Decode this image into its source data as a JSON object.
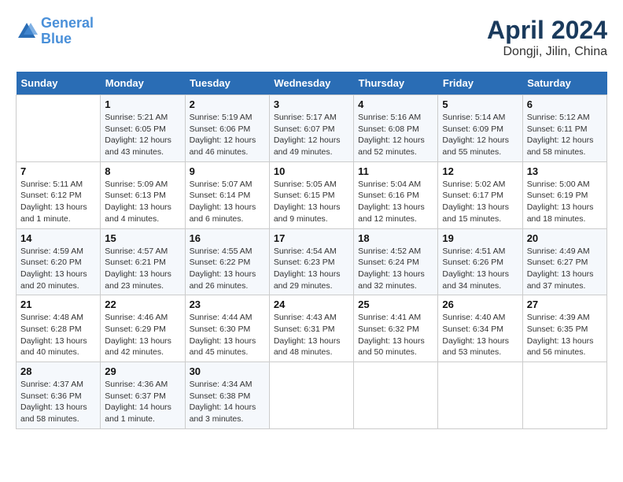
{
  "header": {
    "logo_line1": "General",
    "logo_line2": "Blue",
    "title": "April 2024",
    "subtitle": "Dongji, Jilin, China"
  },
  "columns": [
    "Sunday",
    "Monday",
    "Tuesday",
    "Wednesday",
    "Thursday",
    "Friday",
    "Saturday"
  ],
  "weeks": [
    [
      {
        "day": "",
        "info": ""
      },
      {
        "day": "1",
        "info": "Sunrise: 5:21 AM\nSunset: 6:05 PM\nDaylight: 12 hours\nand 43 minutes."
      },
      {
        "day": "2",
        "info": "Sunrise: 5:19 AM\nSunset: 6:06 PM\nDaylight: 12 hours\nand 46 minutes."
      },
      {
        "day": "3",
        "info": "Sunrise: 5:17 AM\nSunset: 6:07 PM\nDaylight: 12 hours\nand 49 minutes."
      },
      {
        "day": "4",
        "info": "Sunrise: 5:16 AM\nSunset: 6:08 PM\nDaylight: 12 hours\nand 52 minutes."
      },
      {
        "day": "5",
        "info": "Sunrise: 5:14 AM\nSunset: 6:09 PM\nDaylight: 12 hours\nand 55 minutes."
      },
      {
        "day": "6",
        "info": "Sunrise: 5:12 AM\nSunset: 6:11 PM\nDaylight: 12 hours\nand 58 minutes."
      }
    ],
    [
      {
        "day": "7",
        "info": "Sunrise: 5:11 AM\nSunset: 6:12 PM\nDaylight: 13 hours\nand 1 minute."
      },
      {
        "day": "8",
        "info": "Sunrise: 5:09 AM\nSunset: 6:13 PM\nDaylight: 13 hours\nand 4 minutes."
      },
      {
        "day": "9",
        "info": "Sunrise: 5:07 AM\nSunset: 6:14 PM\nDaylight: 13 hours\nand 6 minutes."
      },
      {
        "day": "10",
        "info": "Sunrise: 5:05 AM\nSunset: 6:15 PM\nDaylight: 13 hours\nand 9 minutes."
      },
      {
        "day": "11",
        "info": "Sunrise: 5:04 AM\nSunset: 6:16 PM\nDaylight: 13 hours\nand 12 minutes."
      },
      {
        "day": "12",
        "info": "Sunrise: 5:02 AM\nSunset: 6:17 PM\nDaylight: 13 hours\nand 15 minutes."
      },
      {
        "day": "13",
        "info": "Sunrise: 5:00 AM\nSunset: 6:19 PM\nDaylight: 13 hours\nand 18 minutes."
      }
    ],
    [
      {
        "day": "14",
        "info": "Sunrise: 4:59 AM\nSunset: 6:20 PM\nDaylight: 13 hours\nand 20 minutes."
      },
      {
        "day": "15",
        "info": "Sunrise: 4:57 AM\nSunset: 6:21 PM\nDaylight: 13 hours\nand 23 minutes."
      },
      {
        "day": "16",
        "info": "Sunrise: 4:55 AM\nSunset: 6:22 PM\nDaylight: 13 hours\nand 26 minutes."
      },
      {
        "day": "17",
        "info": "Sunrise: 4:54 AM\nSunset: 6:23 PM\nDaylight: 13 hours\nand 29 minutes."
      },
      {
        "day": "18",
        "info": "Sunrise: 4:52 AM\nSunset: 6:24 PM\nDaylight: 13 hours\nand 32 minutes."
      },
      {
        "day": "19",
        "info": "Sunrise: 4:51 AM\nSunset: 6:26 PM\nDaylight: 13 hours\nand 34 minutes."
      },
      {
        "day": "20",
        "info": "Sunrise: 4:49 AM\nSunset: 6:27 PM\nDaylight: 13 hours\nand 37 minutes."
      }
    ],
    [
      {
        "day": "21",
        "info": "Sunrise: 4:48 AM\nSunset: 6:28 PM\nDaylight: 13 hours\nand 40 minutes."
      },
      {
        "day": "22",
        "info": "Sunrise: 4:46 AM\nSunset: 6:29 PM\nDaylight: 13 hours\nand 42 minutes."
      },
      {
        "day": "23",
        "info": "Sunrise: 4:44 AM\nSunset: 6:30 PM\nDaylight: 13 hours\nand 45 minutes."
      },
      {
        "day": "24",
        "info": "Sunrise: 4:43 AM\nSunset: 6:31 PM\nDaylight: 13 hours\nand 48 minutes."
      },
      {
        "day": "25",
        "info": "Sunrise: 4:41 AM\nSunset: 6:32 PM\nDaylight: 13 hours\nand 50 minutes."
      },
      {
        "day": "26",
        "info": "Sunrise: 4:40 AM\nSunset: 6:34 PM\nDaylight: 13 hours\nand 53 minutes."
      },
      {
        "day": "27",
        "info": "Sunrise: 4:39 AM\nSunset: 6:35 PM\nDaylight: 13 hours\nand 56 minutes."
      }
    ],
    [
      {
        "day": "28",
        "info": "Sunrise: 4:37 AM\nSunset: 6:36 PM\nDaylight: 13 hours\nand 58 minutes."
      },
      {
        "day": "29",
        "info": "Sunrise: 4:36 AM\nSunset: 6:37 PM\nDaylight: 14 hours\nand 1 minute."
      },
      {
        "day": "30",
        "info": "Sunrise: 4:34 AM\nSunset: 6:38 PM\nDaylight: 14 hours\nand 3 minutes."
      },
      {
        "day": "",
        "info": ""
      },
      {
        "day": "",
        "info": ""
      },
      {
        "day": "",
        "info": ""
      },
      {
        "day": "",
        "info": ""
      }
    ]
  ]
}
